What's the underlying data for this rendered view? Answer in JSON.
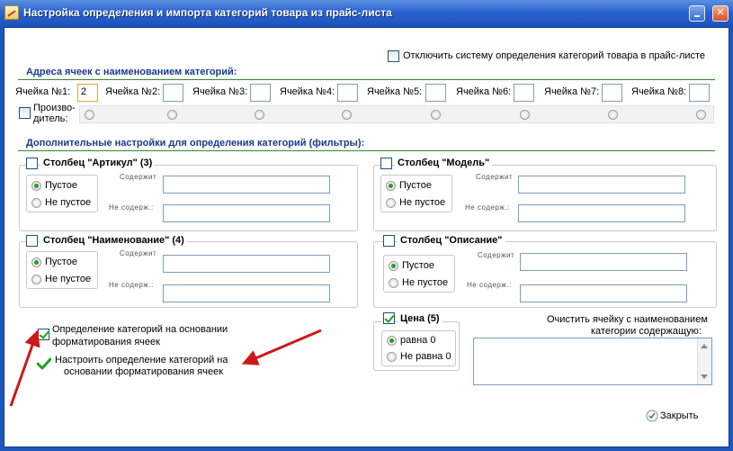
{
  "window": {
    "title": "Настройка определения и импорта категорий товара из прайс-листа"
  },
  "disable_system": {
    "label": "Отключить систему определения категорий товара в прайс-листе",
    "checked": false
  },
  "cells_section": {
    "title": "Адреса ячеек с наименованием категорий:",
    "cells": [
      {
        "label": "Ячейка №1:",
        "value": "2"
      },
      {
        "label": "Ячейка №2:",
        "value": ""
      },
      {
        "label": "Ячейка №3:",
        "value": ""
      },
      {
        "label": "Ячейка №4:",
        "value": ""
      },
      {
        "label": "Ячейка №5:",
        "value": ""
      },
      {
        "label": "Ячейка №6:",
        "value": ""
      },
      {
        "label": "Ячейка №7:",
        "value": ""
      },
      {
        "label": "Ячейка №8:",
        "value": ""
      }
    ],
    "manufacturer_label_1": "Произво-",
    "manufacturer_label_2": "дитель:"
  },
  "filters_section": {
    "title": "Дополнительные настройки для определения категорий (фильтры):",
    "contains_label": "Содержит",
    "not_contains_label": "Не содерж.:",
    "empty_label": "Пустое",
    "not_empty_label": "Не пустое",
    "groups": [
      {
        "id": "article",
        "title": "Столбец \"Артикул\" (3)",
        "checked": false
      },
      {
        "id": "model",
        "title": "Столбец \"Модель\"",
        "checked": false
      },
      {
        "id": "name",
        "title": "Столбец \"Наименование\" (4)",
        "checked": false
      },
      {
        "id": "description",
        "title": "Столбец \"Описание\"",
        "checked": false
      }
    ]
  },
  "format_detection": {
    "label_1": "Определение категорий на основании",
    "label_2": "форматирования ячеек",
    "checked": true,
    "configure_1": "Настроить определение категорий на",
    "configure_2": "основании форматирования ячеек"
  },
  "price_group": {
    "title": "Цена (5)",
    "checked": true,
    "eq_label": "равна 0",
    "neq_label": "Не равна 0"
  },
  "clear_cell": {
    "label_1": "Очистить ячейку с наименованием",
    "label_2": "категории содержащую:"
  },
  "footer": {
    "close_label": "Закрыть"
  },
  "colors": {
    "title_bar": "#2a63cf",
    "section_title": "#1a3a8a",
    "divider": "#2e8b2e",
    "arrow": "#cc1a1a",
    "check": "#21a121"
  }
}
